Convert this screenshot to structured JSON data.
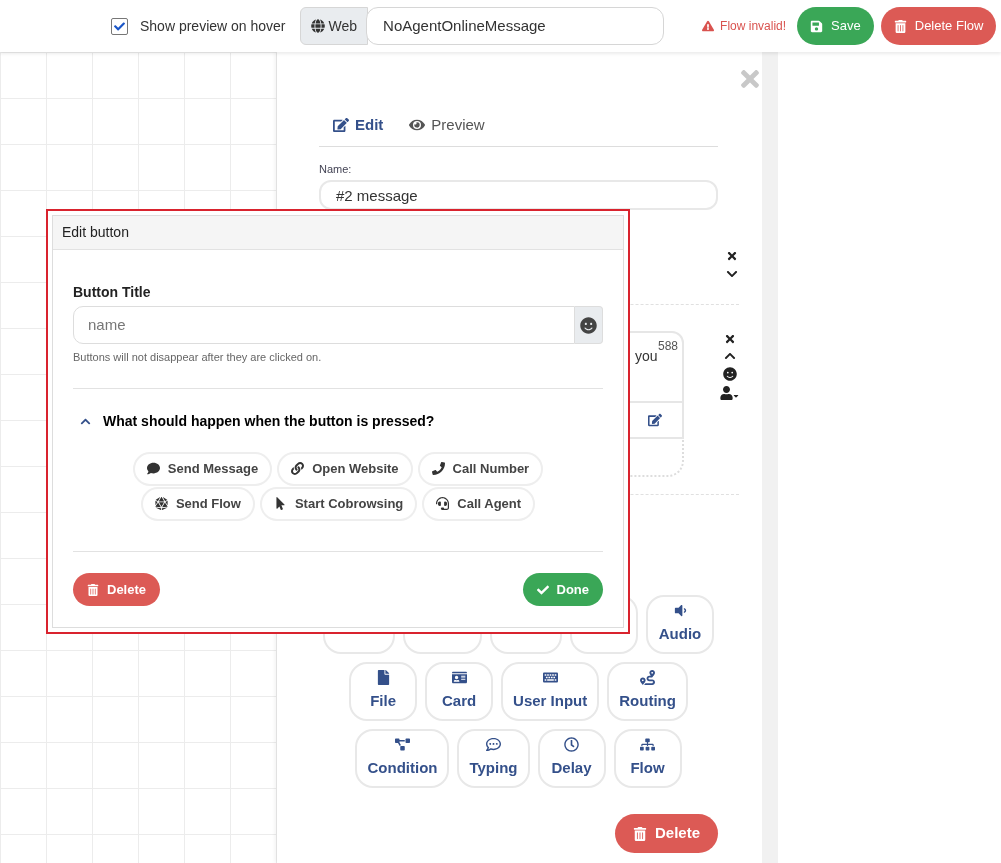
{
  "top_bar": {
    "show_preview": {
      "label": "Show preview on hover",
      "checked": true
    },
    "channel": "Web",
    "flow_name": "NoAgentOnlineMessage",
    "status": "Flow invalid!",
    "save": "Save",
    "delete_flow": "Delete Flow"
  },
  "panel": {
    "tabs": [
      {
        "label": "Edit",
        "kind": "edit",
        "selected": true
      },
      {
        "label": "Preview",
        "kind": "eye",
        "selected": false
      }
    ],
    "name_label": "Name:",
    "name_value": "#2 message",
    "message": {
      "counter": "588",
      "text": "you"
    },
    "block_buttons": [
      [
        {
          "kind": "covered"
        },
        {
          "kind": "covered"
        },
        {
          "kind": "covered"
        },
        {
          "kind": "covered"
        },
        {
          "label": "Audio",
          "kind": "audio"
        }
      ],
      [
        {
          "label": "File",
          "kind": "file"
        },
        {
          "label": "Card",
          "kind": "card"
        },
        {
          "label": "User Input",
          "kind": "keyboard"
        },
        {
          "label": "Routing",
          "kind": "routing"
        }
      ],
      [
        {
          "label": "Condition",
          "kind": "condition"
        },
        {
          "label": "Typing",
          "kind": "typing"
        },
        {
          "label": "Delay",
          "kind": "delay"
        },
        {
          "label": "Flow",
          "kind": "flow"
        }
      ]
    ],
    "delete": "Delete"
  },
  "modal": {
    "title": "Edit button",
    "field_label": "Button Title",
    "placeholder": "name",
    "hint": "Buttons will not disappear after they are clicked on.",
    "section": {
      "title": "What should happen when the button is pressed?",
      "expanded": true
    },
    "actions": [
      [
        {
          "label": "Send Message",
          "kind": "message"
        },
        {
          "label": "Open Website",
          "kind": "link"
        },
        {
          "label": "Call Number",
          "kind": "phone"
        }
      ],
      [
        {
          "label": "Send Flow",
          "kind": "hexagon"
        },
        {
          "label": "Start Cobrowsing",
          "kind": "pointer"
        },
        {
          "label": "Call Agent",
          "kind": "headset"
        }
      ]
    ],
    "delete": "Delete",
    "done": "Done"
  }
}
